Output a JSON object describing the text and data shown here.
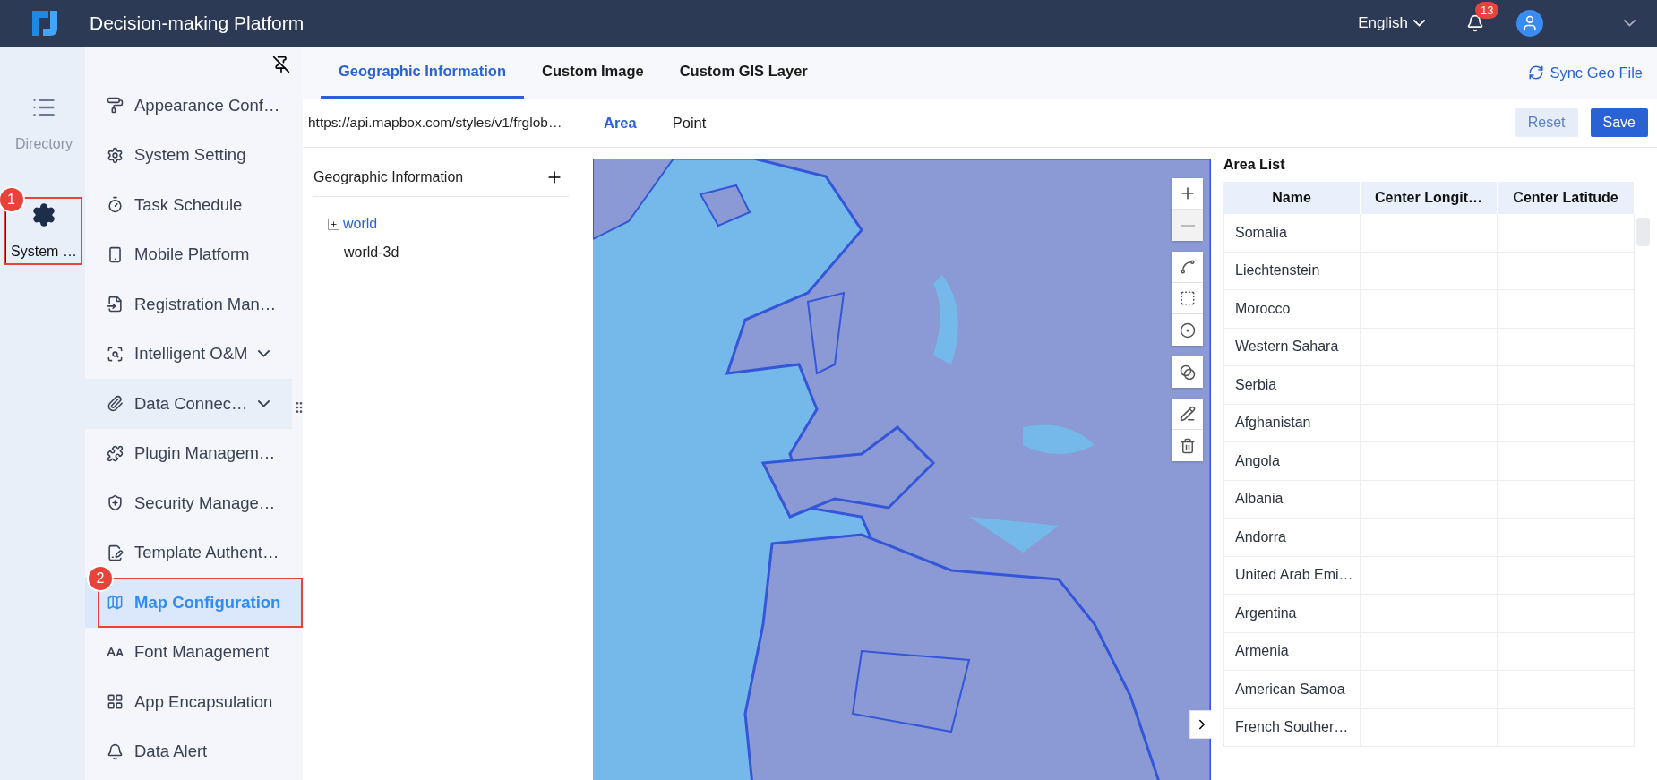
{
  "header": {
    "title": "Decision-making Platform",
    "language": "English",
    "notification_count": "13"
  },
  "rail": [
    {
      "label": "Directory",
      "selected": false
    },
    {
      "label": "System …",
      "selected": true,
      "annotation": "1"
    }
  ],
  "sidebar": {
    "items": [
      {
        "label": "Appearance Conf…",
        "selected": false,
        "expandable": false
      },
      {
        "label": "System Setting",
        "selected": false,
        "expandable": false
      },
      {
        "label": "Task Schedule",
        "selected": false,
        "expandable": false
      },
      {
        "label": "Mobile Platform",
        "selected": false,
        "expandable": false
      },
      {
        "label": "Registration Man…",
        "selected": false,
        "expandable": false
      },
      {
        "label": "Intelligent O&M",
        "selected": false,
        "expandable": true
      },
      {
        "label": "Data Connec…",
        "selected": false,
        "expandable": true
      },
      {
        "label": "Plugin Managem…",
        "selected": false,
        "expandable": false
      },
      {
        "label": "Security Manage…",
        "selected": false,
        "expandable": false
      },
      {
        "label": "Template Authent…",
        "selected": false,
        "expandable": false
      },
      {
        "label": "Map Configuration",
        "selected": true,
        "expandable": false,
        "annotation": "2"
      },
      {
        "label": "Font Management",
        "selected": false,
        "expandable": false
      },
      {
        "label": "App Encapsulation",
        "selected": false,
        "expandable": false
      },
      {
        "label": "Data Alert",
        "selected": false,
        "expandable": false
      }
    ]
  },
  "tabs": [
    {
      "label": "Geographic Information",
      "selected": true
    },
    {
      "label": "Custom Image",
      "selected": false
    },
    {
      "label": "Custom GIS Layer",
      "selected": false
    }
  ],
  "sync_button": "Sync Geo File",
  "url": "https://api.mapbox.com/styles/v1/frglob…",
  "sub_tabs": [
    {
      "label": "Area",
      "selected": true
    },
    {
      "label": "Point",
      "selected": false
    }
  ],
  "buttons": [
    "Reset",
    "Save"
  ],
  "tree": {
    "title": "Geographic Information",
    "items": [
      {
        "label": "world",
        "selected": true,
        "expandable": true
      },
      {
        "label": "world-3d",
        "selected": false,
        "expandable": false
      }
    ]
  },
  "map": {
    "kind": "picture"
  },
  "area_list": {
    "title": "Area List",
    "columns": [
      "Name",
      "Center Longit…",
      "Center Latitude"
    ],
    "rows": [
      "Somalia",
      "Liechtenstein",
      "Morocco",
      "Western Sahara",
      "Serbia",
      "Afghanistan",
      "Angola",
      "Albania",
      "Andorra",
      "United Arab Emi…",
      "Argentina",
      "Armenia",
      "American Samoa",
      "French Souther…"
    ]
  }
}
